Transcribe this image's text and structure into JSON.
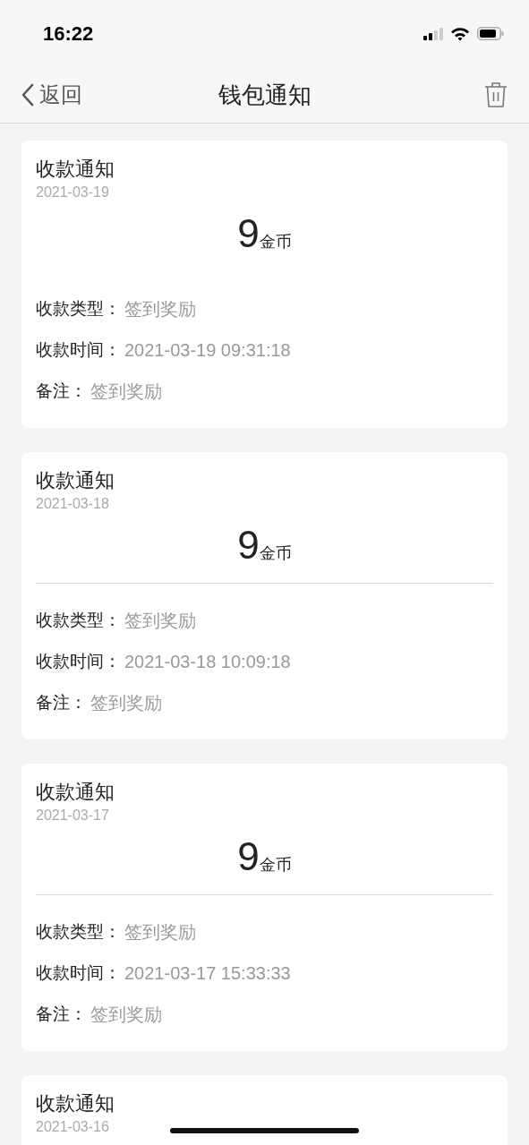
{
  "status_bar": {
    "time": "16:22"
  },
  "nav": {
    "back": "返回",
    "title": "钱包通知"
  },
  "cards": [
    {
      "title": "收款通知",
      "date": "2021-03-19",
      "amount": "9",
      "unit": "金币",
      "divider": false,
      "rows": [
        {
          "label": "收款类型：",
          "value": "签到奖励"
        },
        {
          "label": "收款时间：",
          "value": "2021-03-19 09:31:18"
        },
        {
          "label": "备注：",
          "value": "签到奖励"
        }
      ]
    },
    {
      "title": "收款通知",
      "date": "2021-03-18",
      "amount": "9",
      "unit": "金币",
      "divider": true,
      "rows": [
        {
          "label": "收款类型：",
          "value": "签到奖励"
        },
        {
          "label": "收款时间：",
          "value": "2021-03-18 10:09:18"
        },
        {
          "label": "备注：",
          "value": "签到奖励"
        }
      ]
    },
    {
      "title": "收款通知",
      "date": "2021-03-17",
      "amount": "9",
      "unit": "金币",
      "divider": true,
      "rows": [
        {
          "label": "收款类型：",
          "value": "签到奖励"
        },
        {
          "label": "收款时间：",
          "value": "2021-03-17 15:33:33"
        },
        {
          "label": "备注：",
          "value": "签到奖励"
        }
      ]
    },
    {
      "title": "收款通知",
      "date": "2021-03-16"
    }
  ]
}
